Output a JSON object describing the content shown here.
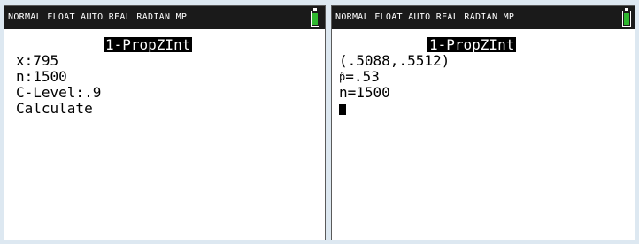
{
  "left_screen": {
    "status": "NORMAL FLOAT AUTO REAL RADIAN MP",
    "title": "1-PropZInt",
    "lines": [
      "x:795",
      "n:1500",
      "C-Level:.9",
      "Calculate"
    ]
  },
  "right_screen": {
    "status": "NORMAL FLOAT AUTO REAL RADIAN MP",
    "title": "1-PropZInt",
    "interval": "(.5088,.5512)",
    "phat_symbol": "p̂",
    "phat_value": "=.53",
    "n_line": "n=1500"
  },
  "colors": {
    "background": "#dde8f1",
    "status_bar": "#1a1a1a",
    "battery_fill": "#2fb82f"
  },
  "icons": [
    "battery-icon",
    "cursor-block"
  ]
}
